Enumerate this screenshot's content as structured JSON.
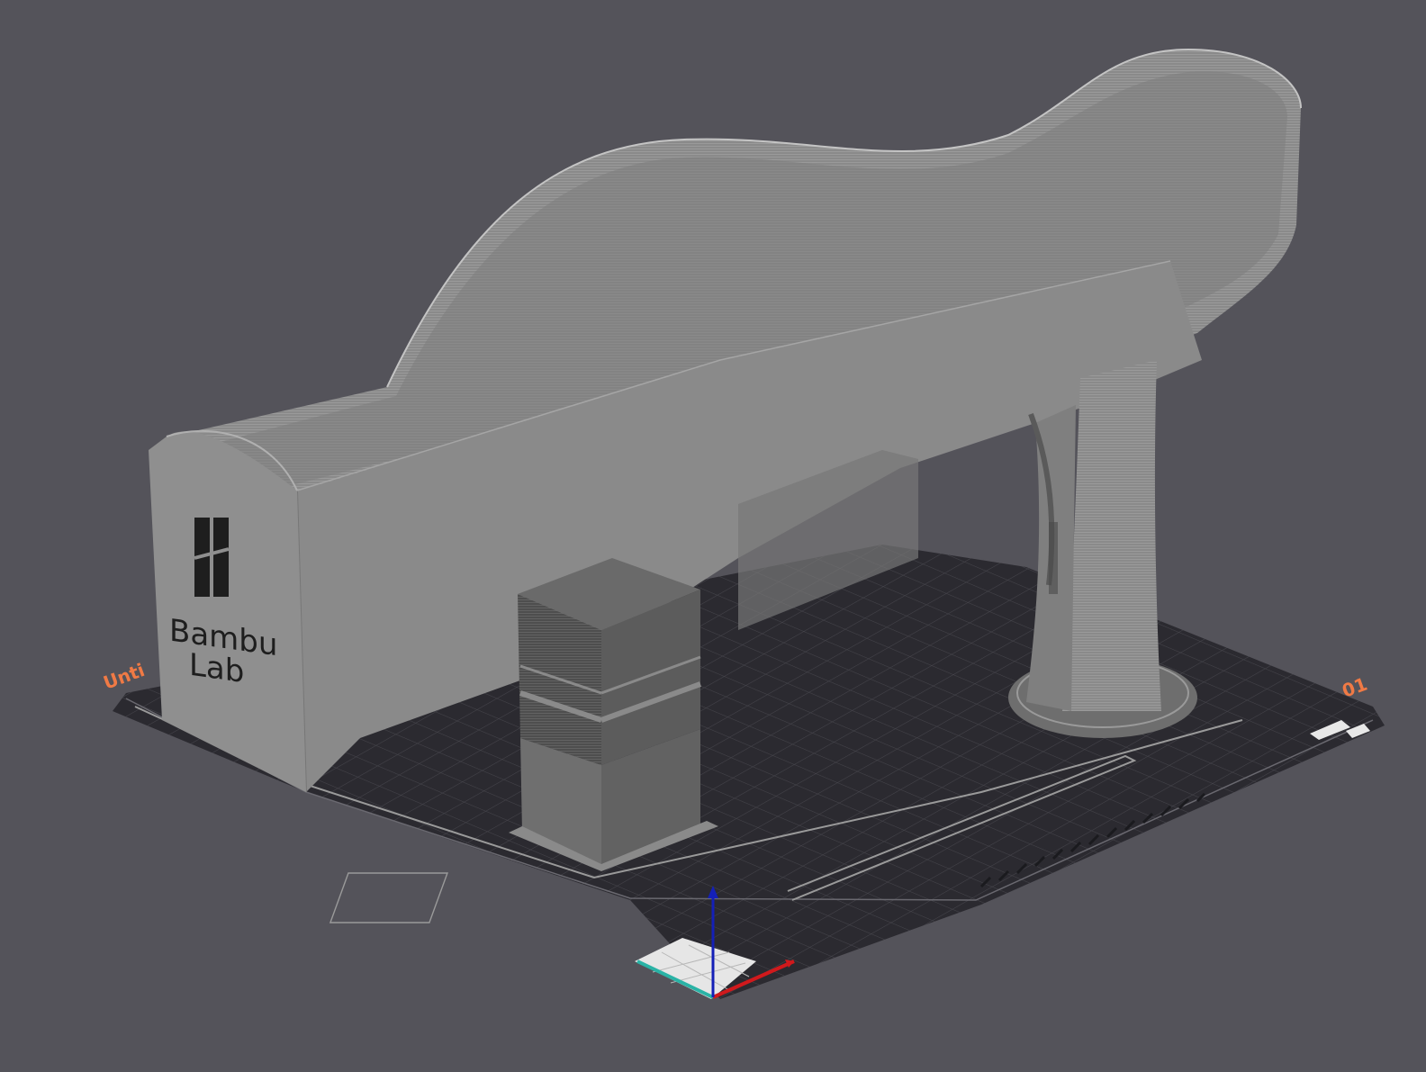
{
  "viewport": {
    "background_color": "#54535a",
    "plate": {
      "name_label": "Unti",
      "number_label": "01",
      "label_color": "#f07a45",
      "bed_color": "#2b2a30",
      "grid_color": "#4a4950"
    },
    "models": [
      {
        "name": "bathtub-shaped-model",
        "color": "#8c8c8c"
      },
      {
        "name": "stacked-block-model",
        "color": "#5e5e5e"
      },
      {
        "name": "pedestal-support-model",
        "color": "#8e8e8e"
      }
    ],
    "logo": {
      "line1": "Bambu",
      "line2": "Lab"
    },
    "axes": {
      "x_color": "#d0191c",
      "y_color": "#2ab3a6",
      "z_color": "#1420b8"
    }
  }
}
